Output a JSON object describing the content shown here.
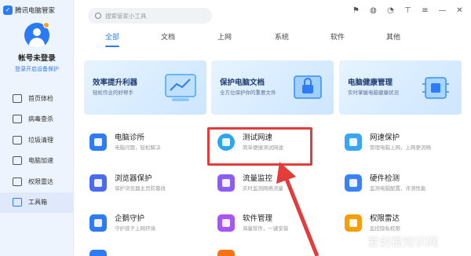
{
  "app": {
    "title": "腾讯电脑管家",
    "brand_color": "#2f7bf5"
  },
  "account": {
    "status": "帐号未登录",
    "subtitle": "登录开启设备保护"
  },
  "sidebar": {
    "items": [
      {
        "label": "首页体检",
        "icon": "monitor-icon"
      },
      {
        "label": "病毒查杀",
        "icon": "shield-icon"
      },
      {
        "label": "垃圾清理",
        "icon": "trash-icon"
      },
      {
        "label": "电脑加速",
        "icon": "speed-icon"
      },
      {
        "label": "权限雷达",
        "icon": "radar-icon"
      },
      {
        "label": "工具箱",
        "icon": "toolbox-icon",
        "active": true
      }
    ]
  },
  "search": {
    "placeholder": "搜索管家小工具"
  },
  "tabs": [
    "全部",
    "文档",
    "上网",
    "系统",
    "软件",
    "其他"
  ],
  "banners": [
    {
      "title": "效率提升利器",
      "subtitle": "轻松作业的好帮手"
    },
    {
      "title": "保护电脑文档",
      "subtitle": "全方位保护你的重要文件"
    },
    {
      "title": "电脑健康管理",
      "subtitle": "实时掌握电脑健康状况"
    }
  ],
  "tools": [
    {
      "name": "电脑诊所",
      "desc": "电脑问题，轻松解决",
      "color": "#2f7bf5"
    },
    {
      "name": "测试网速",
      "desc": "简单便捷测试网速",
      "color": "#2aa6f2"
    },
    {
      "name": "网速保护",
      "desc": "管理电脑上网，上网更流畅",
      "color": "#39a5f5"
    },
    {
      "name": "浏览器保护",
      "desc": "保护浏览器主页防篡改",
      "color": "#4a6bf0"
    },
    {
      "name": "流量监控",
      "desc": "实时监测网络流量",
      "color": "#8b5cf6"
    },
    {
      "name": "硬件检测",
      "desc": "监测电脑配置，评测性能",
      "color": "#3b82f6"
    },
    {
      "name": "企鹅守护",
      "desc": "守护孩子上网环境",
      "color": "#2f7bf5"
    },
    {
      "name": "软件管理",
      "desc": "海量软件，一键安装",
      "color": "#a855f7"
    },
    {
      "name": "权限雷达",
      "desc": "监控隐私权限",
      "color": "#f59e0b"
    }
  ],
  "topbar_icons": [
    "shirt-icon",
    "droplet-icon",
    "bell-icon",
    "tshirt-icon",
    "menu-icon",
    "minimize-icon",
    "close-icon"
  ],
  "watermark": "爱创根知识网",
  "annotation": {
    "box_color": "#e43b3b"
  }
}
